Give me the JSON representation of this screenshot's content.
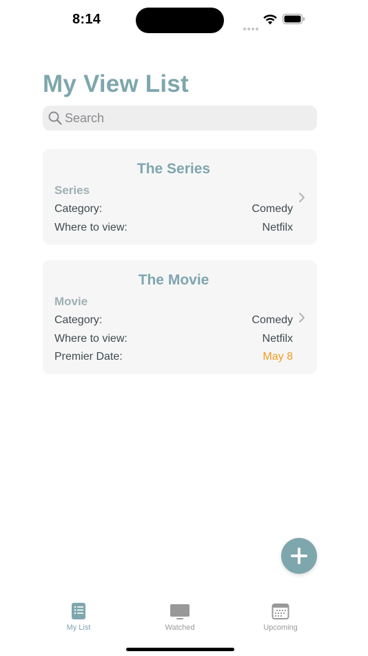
{
  "status_bar": {
    "time": "8:14"
  },
  "page": {
    "title": "My View List"
  },
  "search": {
    "placeholder": "Search",
    "value": ""
  },
  "items": [
    {
      "title": "The Series",
      "type": "Series",
      "rows": [
        {
          "label": "Category:",
          "value": "Comedy"
        },
        {
          "label": "Where to view:",
          "value": "Netfilx"
        }
      ]
    },
    {
      "title": "The Movie",
      "type": "Movie",
      "rows": [
        {
          "label": "Category:",
          "value": "Comedy"
        },
        {
          "label": "Where to view:",
          "value": "Netfilx"
        },
        {
          "label": "Premier Date:",
          "value": "May 8"
        }
      ]
    }
  ],
  "fab": {
    "icon": "plus-icon"
  },
  "tab_bar": {
    "active": "My List",
    "tabs": [
      {
        "label": "My List",
        "icon": "list-icon"
      },
      {
        "label": "Watched",
        "icon": "tv-icon"
      },
      {
        "label": "Upcoming",
        "icon": "calendar-icon"
      }
    ]
  },
  "colors": {
    "accent": "#7ea6ad",
    "date": "#f39b1e",
    "card_background": "#f6f6f7",
    "search_background": "#eeeeef",
    "inactive_tab": "#999999"
  }
}
